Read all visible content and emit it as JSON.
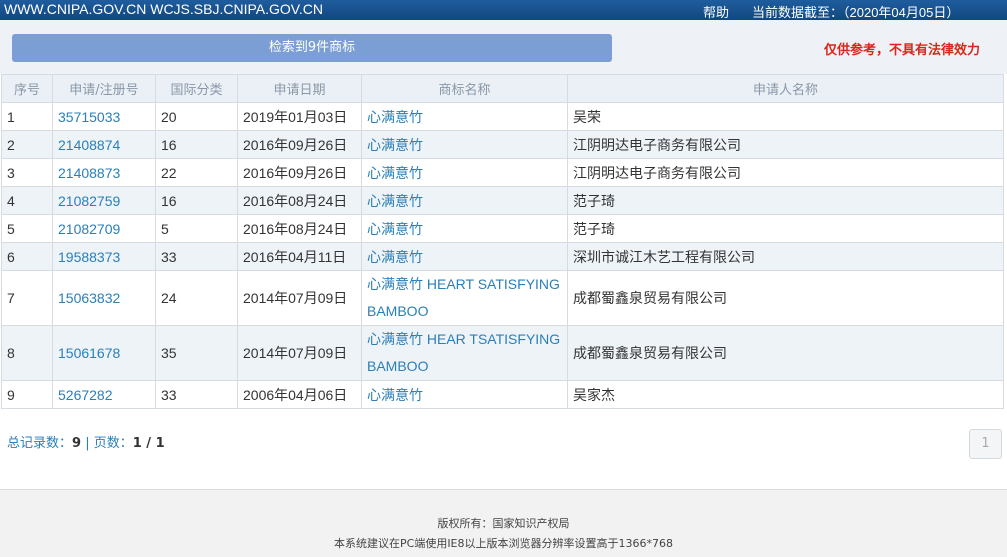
{
  "header": {
    "sites": "WWW.CNIPA.GOV.CN WCJS.SBJ.CNIPA.GOV.CN",
    "help": "帮助",
    "as_of": "当前数据截至：（2020年04月05日）"
  },
  "search": {
    "result_button": "检索到9件商标",
    "disclaimer": "仅供参考，不具有法律效力"
  },
  "table": {
    "headers": [
      "序号",
      "申请/注册号",
      "国际分类",
      "申请日期",
      "商标名称",
      "申请人名称"
    ],
    "rows": [
      {
        "no": "1",
        "reg": "35715033",
        "cls": "20",
        "date": "2019年01月03日",
        "name": "心满意竹",
        "applicant": "吴荣"
      },
      {
        "no": "2",
        "reg": "21408874",
        "cls": "16",
        "date": "2016年09月26日",
        "name": "心满意竹",
        "applicant": "江阴明达电子商务有限公司"
      },
      {
        "no": "3",
        "reg": "21408873",
        "cls": "22",
        "date": "2016年09月26日",
        "name": "心满意竹",
        "applicant": "江阴明达电子商务有限公司"
      },
      {
        "no": "4",
        "reg": "21082759",
        "cls": "16",
        "date": "2016年08月24日",
        "name": "心满意竹",
        "applicant": "范子琦"
      },
      {
        "no": "5",
        "reg": "21082709",
        "cls": "5",
        "date": "2016年08月24日",
        "name": "心满意竹",
        "applicant": "范子琦"
      },
      {
        "no": "6",
        "reg": "19588373",
        "cls": "33",
        "date": "2016年04月11日",
        "name": "心满意竹",
        "applicant": "深圳市诚江木艺工程有限公司"
      },
      {
        "no": "7",
        "reg": "15063832",
        "cls": "24",
        "date": "2014年07月09日",
        "name": "心满意竹 HEART SATISFYING BAMBOO",
        "applicant": "成都蜀鑫泉贸易有限公司"
      },
      {
        "no": "8",
        "reg": "15061678",
        "cls": "35",
        "date": "2014年07月09日",
        "name": "心满意竹 HEAR TSATISFYING BAMBOO",
        "applicant": "成都蜀鑫泉贸易有限公司"
      },
      {
        "no": "9",
        "reg": "5267282",
        "cls": "33",
        "date": "2006年04月06日",
        "name": "心满意竹",
        "applicant": "吴家杰"
      }
    ]
  },
  "summary": {
    "total_label": "总记录数：",
    "total": "9",
    "sep": " | ",
    "pages_label": "页数：",
    "pages": "1 / 1"
  },
  "pager": {
    "current": "1"
  },
  "footer": {
    "copyright": "版权所有：国家知识产权局",
    "note": "本系统建议在PC端使用IE8以上版本浏览器分辨率设置高于1366*768"
  },
  "colors": {
    "topbar": "#11477f",
    "button": "#7b9ed4",
    "disclaimer": "#d9261c",
    "link": "#2a7fb8"
  }
}
